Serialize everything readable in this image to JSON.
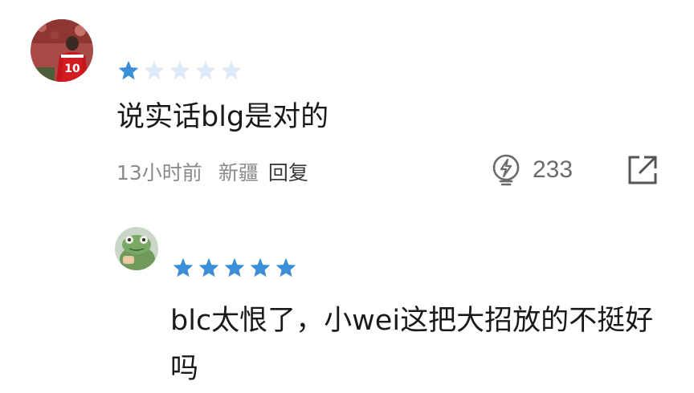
{
  "comments": [
    {
      "rating": 1,
      "text": "说实话blg是对的",
      "time": "13小时前",
      "location": "新疆",
      "reply_label": "回复",
      "likes": "233"
    },
    {
      "rating": 5,
      "text": "blc太恨了，小wei这把大招放的不挺好吗"
    }
  ],
  "colors": {
    "star_filled": "#3c8ed8",
    "star_empty": "#dce9f6"
  },
  "icons": {
    "like": "lightning-bulb-icon",
    "share": "share-external-icon"
  }
}
